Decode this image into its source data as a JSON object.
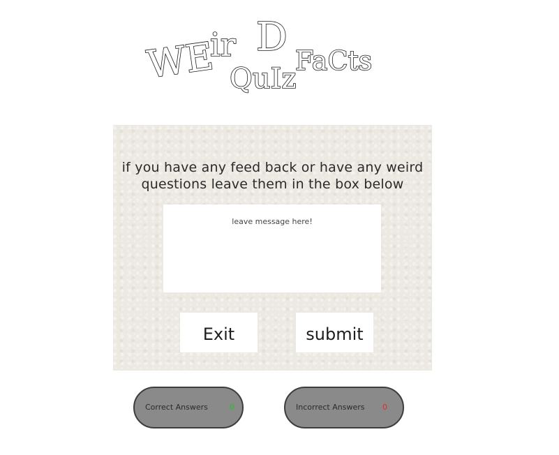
{
  "logo": {
    "line1": "WEirD",
    "line2": "FaCts",
    "line3": "QuIz"
  },
  "feedback": {
    "prompt": "if you have any feed back or have any weird questions leave them in the box below",
    "message_placeholder": "leave message here!",
    "message_value": "",
    "exit_label": "Exit",
    "submit_label": "submit"
  },
  "score": {
    "correct_label": "Correct Answers",
    "correct_count": "0",
    "incorrect_label": "Incorrect Answers",
    "incorrect_count": "0"
  },
  "colors": {
    "correct": "#22c422",
    "incorrect": "#e02a2a",
    "pill_bg": "#8a8a8a",
    "card_bg": "#ece9e2"
  }
}
